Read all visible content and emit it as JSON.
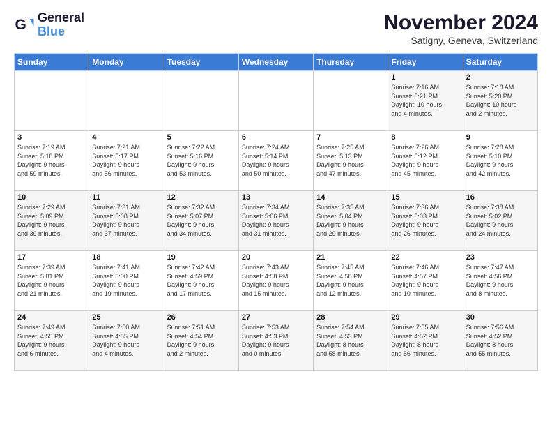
{
  "logo": {
    "line1": "General",
    "line2": "Blue"
  },
  "title": "November 2024",
  "location": "Satigny, Geneva, Switzerland",
  "weekdays": [
    "Sunday",
    "Monday",
    "Tuesday",
    "Wednesday",
    "Thursday",
    "Friday",
    "Saturday"
  ],
  "weeks": [
    [
      {
        "day": "",
        "info": ""
      },
      {
        "day": "",
        "info": ""
      },
      {
        "day": "",
        "info": ""
      },
      {
        "day": "",
        "info": ""
      },
      {
        "day": "",
        "info": ""
      },
      {
        "day": "1",
        "info": "Sunrise: 7:16 AM\nSunset: 5:21 PM\nDaylight: 10 hours\nand 4 minutes."
      },
      {
        "day": "2",
        "info": "Sunrise: 7:18 AM\nSunset: 5:20 PM\nDaylight: 10 hours\nand 2 minutes."
      }
    ],
    [
      {
        "day": "3",
        "info": "Sunrise: 7:19 AM\nSunset: 5:18 PM\nDaylight: 9 hours\nand 59 minutes."
      },
      {
        "day": "4",
        "info": "Sunrise: 7:21 AM\nSunset: 5:17 PM\nDaylight: 9 hours\nand 56 minutes."
      },
      {
        "day": "5",
        "info": "Sunrise: 7:22 AM\nSunset: 5:16 PM\nDaylight: 9 hours\nand 53 minutes."
      },
      {
        "day": "6",
        "info": "Sunrise: 7:24 AM\nSunset: 5:14 PM\nDaylight: 9 hours\nand 50 minutes."
      },
      {
        "day": "7",
        "info": "Sunrise: 7:25 AM\nSunset: 5:13 PM\nDaylight: 9 hours\nand 47 minutes."
      },
      {
        "day": "8",
        "info": "Sunrise: 7:26 AM\nSunset: 5:12 PM\nDaylight: 9 hours\nand 45 minutes."
      },
      {
        "day": "9",
        "info": "Sunrise: 7:28 AM\nSunset: 5:10 PM\nDaylight: 9 hours\nand 42 minutes."
      }
    ],
    [
      {
        "day": "10",
        "info": "Sunrise: 7:29 AM\nSunset: 5:09 PM\nDaylight: 9 hours\nand 39 minutes."
      },
      {
        "day": "11",
        "info": "Sunrise: 7:31 AM\nSunset: 5:08 PM\nDaylight: 9 hours\nand 37 minutes."
      },
      {
        "day": "12",
        "info": "Sunrise: 7:32 AM\nSunset: 5:07 PM\nDaylight: 9 hours\nand 34 minutes."
      },
      {
        "day": "13",
        "info": "Sunrise: 7:34 AM\nSunset: 5:06 PM\nDaylight: 9 hours\nand 31 minutes."
      },
      {
        "day": "14",
        "info": "Sunrise: 7:35 AM\nSunset: 5:04 PM\nDaylight: 9 hours\nand 29 minutes."
      },
      {
        "day": "15",
        "info": "Sunrise: 7:36 AM\nSunset: 5:03 PM\nDaylight: 9 hours\nand 26 minutes."
      },
      {
        "day": "16",
        "info": "Sunrise: 7:38 AM\nSunset: 5:02 PM\nDaylight: 9 hours\nand 24 minutes."
      }
    ],
    [
      {
        "day": "17",
        "info": "Sunrise: 7:39 AM\nSunset: 5:01 PM\nDaylight: 9 hours\nand 21 minutes."
      },
      {
        "day": "18",
        "info": "Sunrise: 7:41 AM\nSunset: 5:00 PM\nDaylight: 9 hours\nand 19 minutes."
      },
      {
        "day": "19",
        "info": "Sunrise: 7:42 AM\nSunset: 4:59 PM\nDaylight: 9 hours\nand 17 minutes."
      },
      {
        "day": "20",
        "info": "Sunrise: 7:43 AM\nSunset: 4:58 PM\nDaylight: 9 hours\nand 15 minutes."
      },
      {
        "day": "21",
        "info": "Sunrise: 7:45 AM\nSunset: 4:58 PM\nDaylight: 9 hours\nand 12 minutes."
      },
      {
        "day": "22",
        "info": "Sunrise: 7:46 AM\nSunset: 4:57 PM\nDaylight: 9 hours\nand 10 minutes."
      },
      {
        "day": "23",
        "info": "Sunrise: 7:47 AM\nSunset: 4:56 PM\nDaylight: 9 hours\nand 8 minutes."
      }
    ],
    [
      {
        "day": "24",
        "info": "Sunrise: 7:49 AM\nSunset: 4:55 PM\nDaylight: 9 hours\nand 6 minutes."
      },
      {
        "day": "25",
        "info": "Sunrise: 7:50 AM\nSunset: 4:55 PM\nDaylight: 9 hours\nand 4 minutes."
      },
      {
        "day": "26",
        "info": "Sunrise: 7:51 AM\nSunset: 4:54 PM\nDaylight: 9 hours\nand 2 minutes."
      },
      {
        "day": "27",
        "info": "Sunrise: 7:53 AM\nSunset: 4:53 PM\nDaylight: 9 hours\nand 0 minutes."
      },
      {
        "day": "28",
        "info": "Sunrise: 7:54 AM\nSunset: 4:53 PM\nDaylight: 8 hours\nand 58 minutes."
      },
      {
        "day": "29",
        "info": "Sunrise: 7:55 AM\nSunset: 4:52 PM\nDaylight: 8 hours\nand 56 minutes."
      },
      {
        "day": "30",
        "info": "Sunrise: 7:56 AM\nSunset: 4:52 PM\nDaylight: 8 hours\nand 55 minutes."
      }
    ]
  ]
}
